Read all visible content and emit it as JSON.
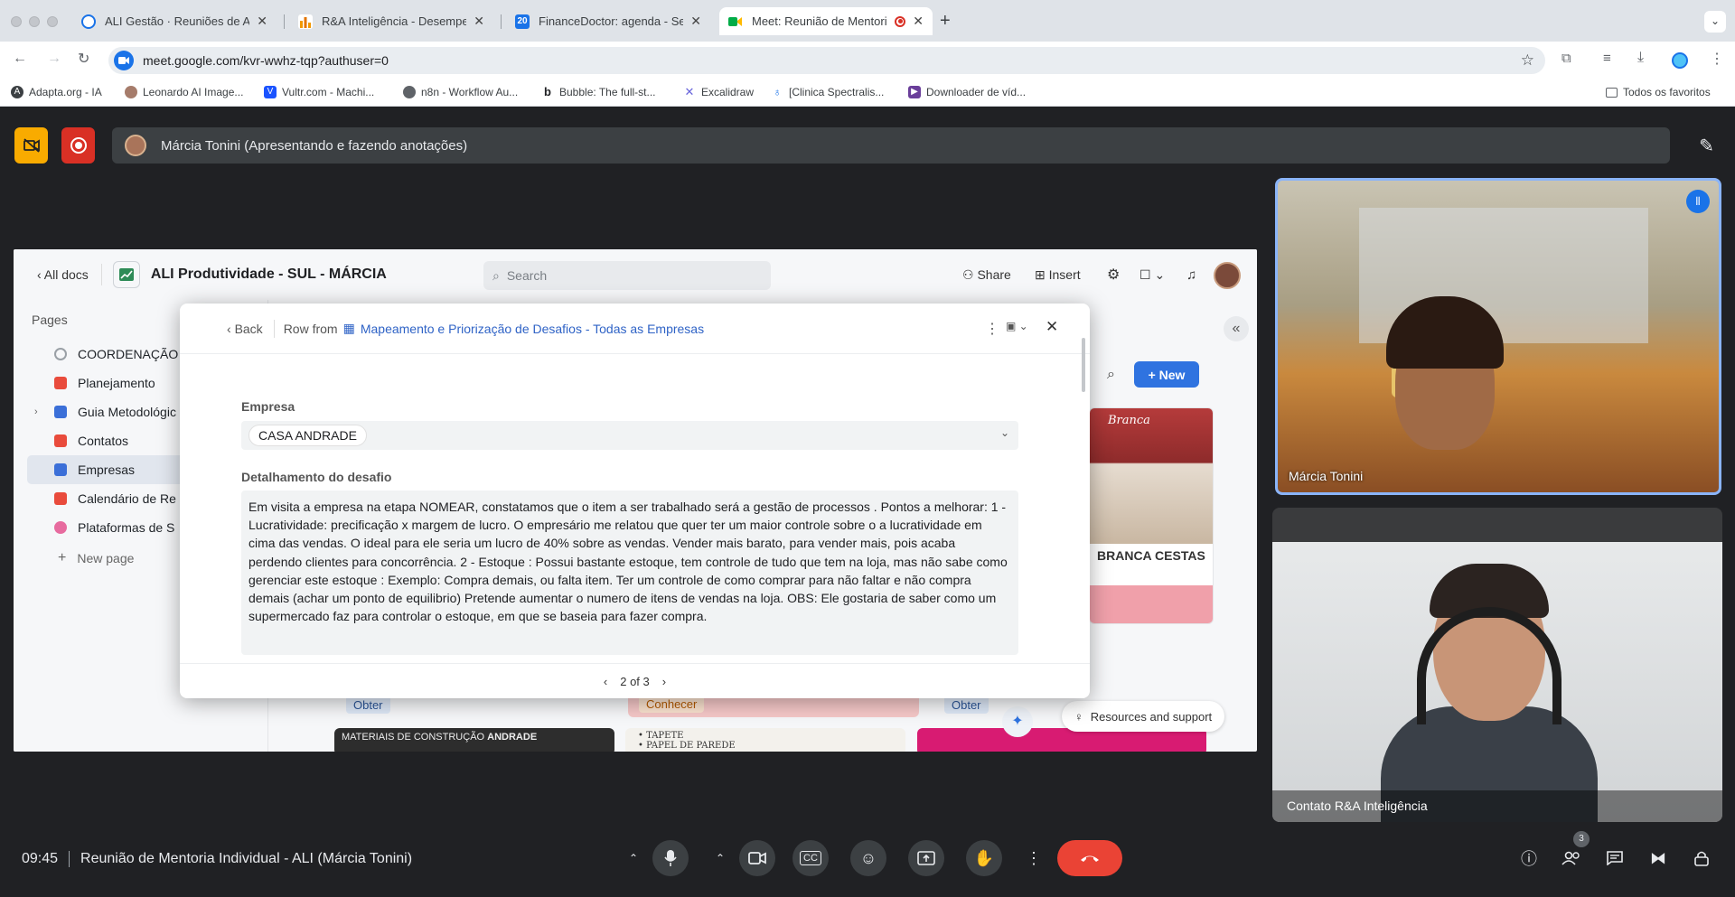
{
  "browser": {
    "tabs": [
      {
        "title": "ALI Gestão · Reuniões de Alin",
        "icon": "target-icon",
        "color": "#1a73e8"
      },
      {
        "title": "R&A Inteligência - Desempenh",
        "icon": "bar-chart-icon",
        "color": "#f29900"
      },
      {
        "title": "FinanceDoctor: agenda - Sem",
        "icon": "calendar-icon",
        "color": "#1a73e8"
      },
      {
        "title": "Meet: Reunião de Mentori",
        "icon": "meet-icon",
        "color": "#00897b"
      }
    ],
    "url": "meet.google.com/kvr-wwhz-tqp?authuser=0",
    "bookmarks": [
      "Adapta.org - IA",
      "Leonardo AI Image...",
      "Vultr.com - Machi...",
      "n8n - Workflow Au...",
      "Bubble: The full-st...",
      "Excalidraw",
      "[Clinica Spectralis...",
      "Downloader de víd..."
    ],
    "all_bookmarks": "Todos os favoritos"
  },
  "meet": {
    "presenter_text": "Márcia Tonini (Apresentando e fazendo anotações)",
    "time": "09:45",
    "meeting_title": "Reunião de Mentoria Individual - ALI (Márcia Tonini)",
    "participants_count": "3",
    "participants": [
      {
        "name": "Márcia Tonini"
      },
      {
        "name": "Contato R&A Inteligência"
      }
    ],
    "accent": "#8ab4f8",
    "end_call_color": "#ea4335"
  },
  "doc": {
    "all_docs": "All docs",
    "title": "ALI Produtividade - SUL - MÁRCIA",
    "search_placeholder": "Search",
    "share": "Share",
    "insert": "Insert",
    "pages_label": "Pages",
    "pages": [
      {
        "label": "COORDENAÇÃO",
        "color": "#9aa0a6"
      },
      {
        "label": "Planejamento",
        "color": "#e94b3c"
      },
      {
        "label": "Guia Metodológic",
        "color": "#3b6fd8"
      },
      {
        "label": "Contatos",
        "color": "#e94b3c"
      },
      {
        "label": "Empresas",
        "color": "#3b6fd8"
      },
      {
        "label": "Calendário de Re",
        "color": "#e94b3c"
      },
      {
        "label": "Plataformas de S",
        "color": "#e76b9f"
      }
    ],
    "new_page": "New page",
    "new_button": "New",
    "card_caption": "BRANCA CESTAS",
    "tags": [
      "Obter",
      "Conhecer",
      "Obter"
    ],
    "resources": "Resources and support",
    "tile_text": [
      "MATERIAIS DE CONSTRUÇÃO",
      "ANDRADE",
      "• TAPETE",
      "• PAPEL DE PAREDE"
    ],
    "logo_text": "Branca"
  },
  "modal": {
    "back": "Back",
    "row_from": "Row from",
    "table_name": "Mapeamento e Priorização de Desafios - Todas as Empresas",
    "empresa_label": "Empresa",
    "empresa_value": "CASA ANDRADE",
    "detail_label": "Detalhamento do desafio",
    "detail_text": "Em visita a empresa na etapa NOMEAR, constatamos que o item a ser trabalhado será a gestão de processos . Pontos a melhorar:  1 - Lucratividade:  precificação x margem de lucro. O empresário me relatou que quer ter um maior controle sobre o a lucratividade em cima das vendas. O ideal para ele seria um lucro de 40% sobre as vendas.  Vender mais barato, para vender mais, pois acaba perdendo clientes para concorrência. 2 - Estoque : Possui bastante estoque, tem controle de tudo que tem na loja, mas não sabe como gerenciar este estoque : Exemplo: Compra demais, ou falta item. Ter um controle de como comprar para não faltar e não compra demais (achar um ponto de equilibrio) Pretende aumentar o numero de itens de vendas na loja. OBS: Ele gostaria de saber como um supermercado faz para controlar o estoque, em que se baseia para fazer compra.",
    "pager": "2 of 3"
  }
}
